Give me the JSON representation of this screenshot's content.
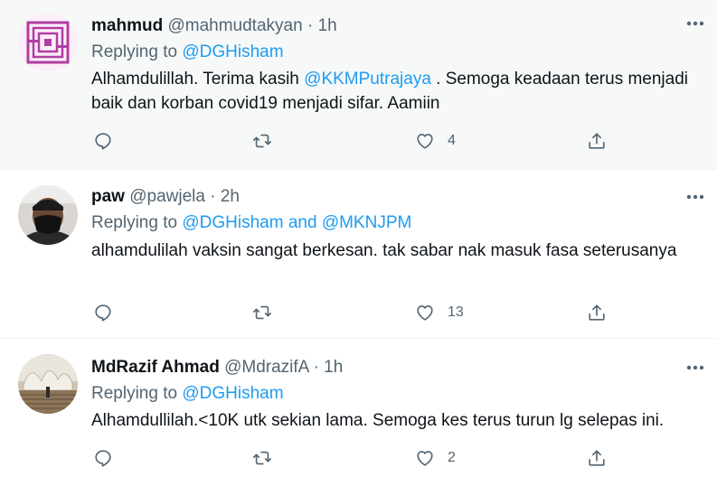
{
  "tweets": [
    {
      "name": "mahmud",
      "handle": "@mahmudtakyan",
      "dot": "·",
      "time": "1h",
      "replying_prefix": "Replying to ",
      "replying_to": "@DGHisham",
      "replying_and": "",
      "replying_to_2": "",
      "text_before": "Alhamdulillah. Terima kasih ",
      "text_mention": "@KKMPutrajaya",
      "text_after": " . Semoga keadaan terus menjadi baik dan korban covid19 menjadi sifar. Aamiin",
      "like_count": "4"
    },
    {
      "name": "paw",
      "handle": "@pawjela",
      "dot": "·",
      "time": "2h",
      "replying_prefix": "Replying to ",
      "replying_to": "@DGHisham",
      "replying_and": " and ",
      "replying_to_2": "@MKNJPM",
      "text_before": "alhamdulilah vaksin sangat berkesan. tak sabar nak masuk fasa seterusanya",
      "text_mention": "",
      "text_after": "",
      "like_count": "13"
    },
    {
      "name": "MdRazif Ahmad",
      "handle": "@MdrazifA",
      "dot": "·",
      "time": "1h",
      "replying_prefix": "Replying to ",
      "replying_to": "@DGHisham",
      "replying_and": "",
      "replying_to_2": "",
      "text_before": "Alhamdullilah.<10K utk sekian lama. Semoga kes terus turun lg selepas ini.",
      "text_mention": "",
      "text_after": "",
      "like_count": "2"
    }
  ],
  "icons": {
    "reply": "reply-icon",
    "retweet": "retweet-icon",
    "like": "heart-icon",
    "share": "share-icon",
    "more": "more-icon"
  },
  "colors": {
    "accent": "#1d9bf0",
    "secondary_text": "#536471",
    "primary_text": "#0f1419",
    "hover_bg": "#f7f9f9"
  }
}
